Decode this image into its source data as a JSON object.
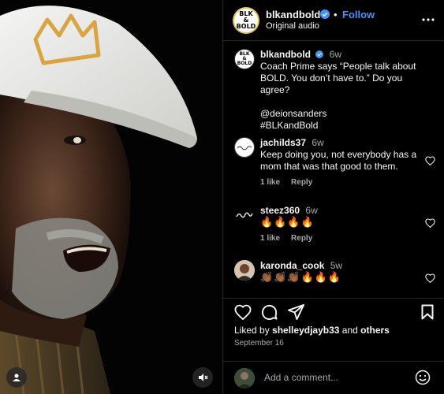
{
  "post": {
    "username": "blkandbold",
    "follow_label": "Follow",
    "dot": "•",
    "subtitle": "Original audio",
    "logo_text_1": "BLK",
    "logo_text_2": "&",
    "logo_text_3": "BOLD"
  },
  "caption": {
    "username": "blkandbold",
    "time": "6w",
    "text_line1": "Coach Prime says “People talk about",
    "text_line2": "BOLD. You don’t have to.” Do you agree?",
    "mention": "@deionsanders",
    "hashtag": "#BLKandBold"
  },
  "comments": [
    {
      "username": "jachilds37",
      "time": "6w",
      "text": "Keep doing you, not everybody has a mom that was that good to them.",
      "likes": "1 like",
      "reply": "Reply"
    },
    {
      "username": "steez360",
      "time": "6w",
      "text": "🔥🔥🔥🔥",
      "likes": "1 like",
      "reply": "Reply"
    },
    {
      "username": "karonda_cook",
      "time": "5w",
      "text": "👏🏾👏🏾👏🏾🔥🔥🔥"
    }
  ],
  "footer": {
    "liked_by_prefix": "Liked by",
    "liked_by_user": "shelleydjayb33",
    "liked_by_and": "and",
    "liked_by_others": "others",
    "date": "September 16",
    "comment_placeholder": "Add a comment..."
  },
  "colors": {
    "accent": "#4193f7",
    "background": "#000000",
    "muted": "#a8a8a8",
    "cap_gold": "#d9a441"
  }
}
